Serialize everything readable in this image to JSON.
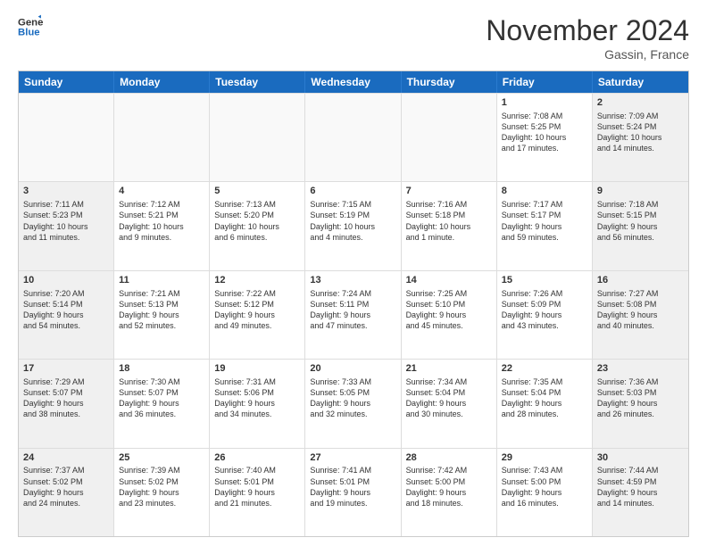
{
  "header": {
    "logo_line1": "General",
    "logo_line2": "Blue",
    "month": "November 2024",
    "location": "Gassin, France"
  },
  "weekdays": [
    "Sunday",
    "Monday",
    "Tuesday",
    "Wednesday",
    "Thursday",
    "Friday",
    "Saturday"
  ],
  "rows": [
    [
      {
        "day": "",
        "text": "",
        "empty": true
      },
      {
        "day": "",
        "text": "",
        "empty": true
      },
      {
        "day": "",
        "text": "",
        "empty": true
      },
      {
        "day": "",
        "text": "",
        "empty": true
      },
      {
        "day": "",
        "text": "",
        "empty": true
      },
      {
        "day": "1",
        "text": "Sunrise: 7:08 AM\nSunset: 5:25 PM\nDaylight: 10 hours\nand 17 minutes.",
        "empty": false
      },
      {
        "day": "2",
        "text": "Sunrise: 7:09 AM\nSunset: 5:24 PM\nDaylight: 10 hours\nand 14 minutes.",
        "empty": false,
        "shaded": true
      }
    ],
    [
      {
        "day": "3",
        "text": "Sunrise: 7:11 AM\nSunset: 5:23 PM\nDaylight: 10 hours\nand 11 minutes.",
        "empty": false,
        "shaded": true
      },
      {
        "day": "4",
        "text": "Sunrise: 7:12 AM\nSunset: 5:21 PM\nDaylight: 10 hours\nand 9 minutes.",
        "empty": false
      },
      {
        "day": "5",
        "text": "Sunrise: 7:13 AM\nSunset: 5:20 PM\nDaylight: 10 hours\nand 6 minutes.",
        "empty": false
      },
      {
        "day": "6",
        "text": "Sunrise: 7:15 AM\nSunset: 5:19 PM\nDaylight: 10 hours\nand 4 minutes.",
        "empty": false
      },
      {
        "day": "7",
        "text": "Sunrise: 7:16 AM\nSunset: 5:18 PM\nDaylight: 10 hours\nand 1 minute.",
        "empty": false
      },
      {
        "day": "8",
        "text": "Sunrise: 7:17 AM\nSunset: 5:17 PM\nDaylight: 9 hours\nand 59 minutes.",
        "empty": false
      },
      {
        "day": "9",
        "text": "Sunrise: 7:18 AM\nSunset: 5:15 PM\nDaylight: 9 hours\nand 56 minutes.",
        "empty": false,
        "shaded": true
      }
    ],
    [
      {
        "day": "10",
        "text": "Sunrise: 7:20 AM\nSunset: 5:14 PM\nDaylight: 9 hours\nand 54 minutes.",
        "empty": false,
        "shaded": true
      },
      {
        "day": "11",
        "text": "Sunrise: 7:21 AM\nSunset: 5:13 PM\nDaylight: 9 hours\nand 52 minutes.",
        "empty": false
      },
      {
        "day": "12",
        "text": "Sunrise: 7:22 AM\nSunset: 5:12 PM\nDaylight: 9 hours\nand 49 minutes.",
        "empty": false
      },
      {
        "day": "13",
        "text": "Sunrise: 7:24 AM\nSunset: 5:11 PM\nDaylight: 9 hours\nand 47 minutes.",
        "empty": false
      },
      {
        "day": "14",
        "text": "Sunrise: 7:25 AM\nSunset: 5:10 PM\nDaylight: 9 hours\nand 45 minutes.",
        "empty": false
      },
      {
        "day": "15",
        "text": "Sunrise: 7:26 AM\nSunset: 5:09 PM\nDaylight: 9 hours\nand 43 minutes.",
        "empty": false
      },
      {
        "day": "16",
        "text": "Sunrise: 7:27 AM\nSunset: 5:08 PM\nDaylight: 9 hours\nand 40 minutes.",
        "empty": false,
        "shaded": true
      }
    ],
    [
      {
        "day": "17",
        "text": "Sunrise: 7:29 AM\nSunset: 5:07 PM\nDaylight: 9 hours\nand 38 minutes.",
        "empty": false,
        "shaded": true
      },
      {
        "day": "18",
        "text": "Sunrise: 7:30 AM\nSunset: 5:07 PM\nDaylight: 9 hours\nand 36 minutes.",
        "empty": false
      },
      {
        "day": "19",
        "text": "Sunrise: 7:31 AM\nSunset: 5:06 PM\nDaylight: 9 hours\nand 34 minutes.",
        "empty": false
      },
      {
        "day": "20",
        "text": "Sunrise: 7:33 AM\nSunset: 5:05 PM\nDaylight: 9 hours\nand 32 minutes.",
        "empty": false
      },
      {
        "day": "21",
        "text": "Sunrise: 7:34 AM\nSunset: 5:04 PM\nDaylight: 9 hours\nand 30 minutes.",
        "empty": false
      },
      {
        "day": "22",
        "text": "Sunrise: 7:35 AM\nSunset: 5:04 PM\nDaylight: 9 hours\nand 28 minutes.",
        "empty": false
      },
      {
        "day": "23",
        "text": "Sunrise: 7:36 AM\nSunset: 5:03 PM\nDaylight: 9 hours\nand 26 minutes.",
        "empty": false,
        "shaded": true
      }
    ],
    [
      {
        "day": "24",
        "text": "Sunrise: 7:37 AM\nSunset: 5:02 PM\nDaylight: 9 hours\nand 24 minutes.",
        "empty": false,
        "shaded": true
      },
      {
        "day": "25",
        "text": "Sunrise: 7:39 AM\nSunset: 5:02 PM\nDaylight: 9 hours\nand 23 minutes.",
        "empty": false
      },
      {
        "day": "26",
        "text": "Sunrise: 7:40 AM\nSunset: 5:01 PM\nDaylight: 9 hours\nand 21 minutes.",
        "empty": false
      },
      {
        "day": "27",
        "text": "Sunrise: 7:41 AM\nSunset: 5:01 PM\nDaylight: 9 hours\nand 19 minutes.",
        "empty": false
      },
      {
        "day": "28",
        "text": "Sunrise: 7:42 AM\nSunset: 5:00 PM\nDaylight: 9 hours\nand 18 minutes.",
        "empty": false
      },
      {
        "day": "29",
        "text": "Sunrise: 7:43 AM\nSunset: 5:00 PM\nDaylight: 9 hours\nand 16 minutes.",
        "empty": false
      },
      {
        "day": "30",
        "text": "Sunrise: 7:44 AM\nSunset: 4:59 PM\nDaylight: 9 hours\nand 14 minutes.",
        "empty": false,
        "shaded": true
      }
    ]
  ]
}
